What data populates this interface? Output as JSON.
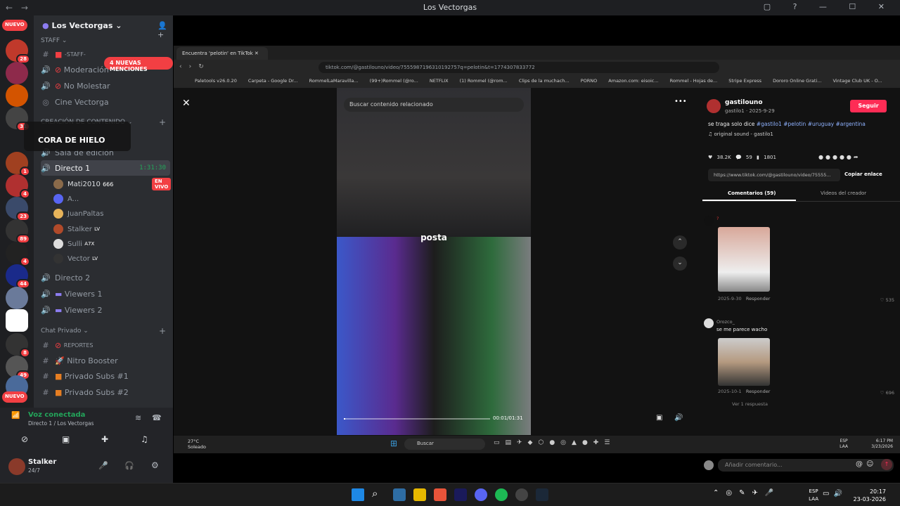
{
  "window": {
    "title": "Los Vectorgas"
  },
  "servers": {
    "top_pill": "NUEVO",
    "bottom_pill": "NUEVO",
    "badges": [
      "28",
      "31",
      "1",
      "4",
      "23",
      "89",
      "4",
      "44",
      "8",
      "49"
    ]
  },
  "server": {
    "name": "Los Vectorgas"
  },
  "mentions": "4 NUEVAS MENCIONES",
  "categories": {
    "staff": "STAFF",
    "creacion": "CREACIÓN DE CONTENIDO",
    "privado": "Chat Privado"
  },
  "channels": {
    "staff_text": "-STAFF-",
    "moderacion": "Moderación",
    "no_molestar": "No Molestar",
    "cine": "Cine Vectorga",
    "edicion": "Sala de edición",
    "directo1": "Directo 1",
    "directo1_time": "1:31:30",
    "directo2": "Directo 2",
    "viewers1": "Viewers 1",
    "viewers2": "Viewers 2",
    "reportes": "REPORTES",
    "nitro": "Nitro Booster",
    "subs1": "Privado Subs #1",
    "subs2": "Privado Subs #2"
  },
  "hover_card": {
    "name": "CORA DE HIELO"
  },
  "voice_users": [
    {
      "name": "Mati2010",
      "tag": "666",
      "live": "EN VIVO"
    },
    {
      "name": "A..."
    },
    {
      "name": "JuanPaltas"
    },
    {
      "name": "Stalker",
      "tag": "LV"
    },
    {
      "name": "Sulli",
      "tag": "A7X"
    },
    {
      "name": "Vector",
      "tag": "LV"
    }
  ],
  "voice": {
    "status": "Voz conectada",
    "location": "Directo 1 / Los Vectorgas"
  },
  "user": {
    "name": "Stalker",
    "status": "24/7"
  },
  "browser": {
    "tab_title": "Encuentra 'pelotin' en TikTok",
    "url": "tiktok.com/@gastilouno/video/7555987196310192757q=pelotin&t=1774307833772",
    "bookmarks": [
      "Paletools v26.0.20",
      "Carpeta - Google Dr...",
      "RommelLaMaravilla...",
      "(99+)Rommel (@ro...",
      "NETFLIX",
      "(1) Rommel (@rom...",
      "Clips de la muchach...",
      "PORNO",
      "Amazon.com: eisoic...",
      "Rommel - Hojas de...",
      "Stripe Express",
      "Dororo Online Grati...",
      "Vintage Club UK - O..."
    ]
  },
  "tiktok": {
    "search_placeholder": "Buscar contenido relacionado",
    "caption": "posta",
    "time": "00:01/01:31",
    "progress_fraction": 0.01,
    "author": "gastilouno",
    "author_sub": "gastilo1 · 2025-9-29",
    "follow": "Seguir",
    "desc": "se traga solo dice",
    "tags": "#gastilo1 #pelotin #uruguay #argentina",
    "sound": "original sound - gastilo1",
    "likes": "38.2K",
    "comments": "59",
    "saves": "1801",
    "link": "https://www.tiktok.com/@gastilouno/video/75555...",
    "copy": "Copiar enlace",
    "tab_comments": "Comentarios (59)",
    "tab_videos": "Videos del creador",
    "comment1": {
      "user": "?",
      "date": "2025-9-30",
      "reply": "Responder",
      "likes": "535"
    },
    "comment2": {
      "user": "Orozco_",
      "text": "se me parece wacho",
      "date": "2025-10-1",
      "reply": "Responder",
      "likes": "696",
      "more": "Ver 1 respuesta"
    },
    "input_placeholder": "Añadir comentario..."
  },
  "inner_taskbar": {
    "weather_temp": "27°C",
    "weather_desc": "Soleado",
    "search": "Buscar",
    "lang1": "ESP",
    "lang2": "LAA",
    "time": "6:17 PM",
    "date": "3/23/2026"
  },
  "outer_taskbar": {
    "lang1": "ESP",
    "lang2": "LAA",
    "time": "20:17",
    "date": "23-03-2026"
  }
}
